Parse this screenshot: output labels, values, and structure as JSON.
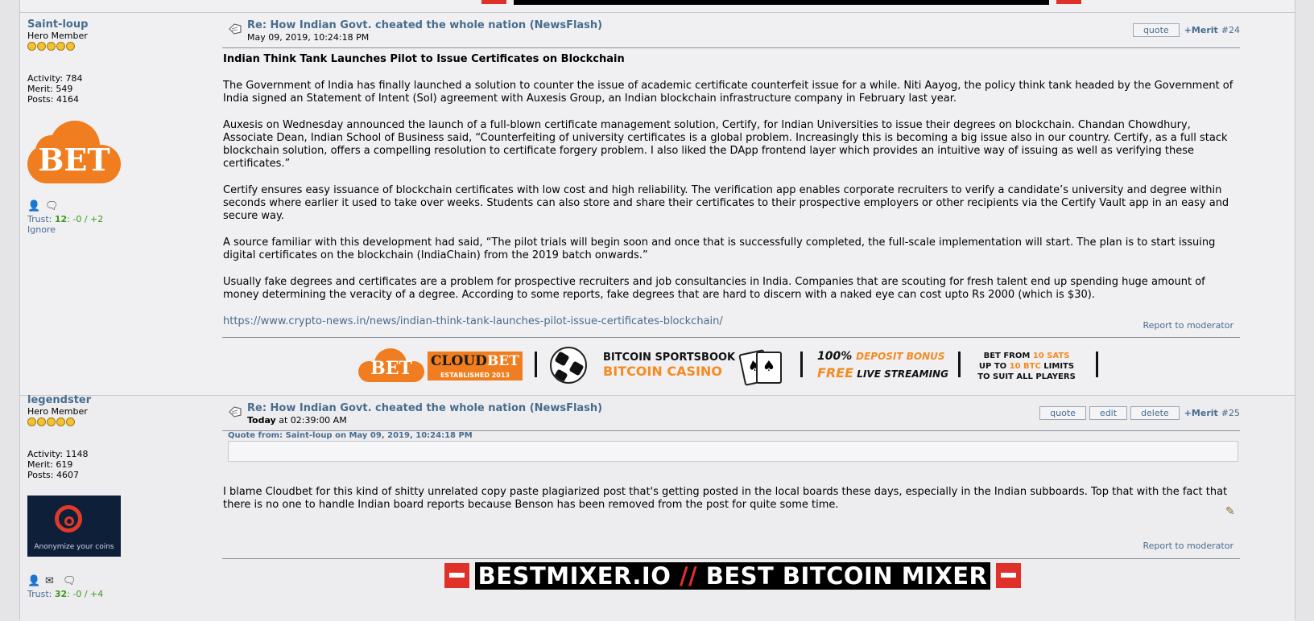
{
  "post1": {
    "poster": {
      "username": "Saint-loup",
      "rank": "Hero Member",
      "activity": "Activity: 784",
      "merit": "Merit: 549",
      "posts": "Posts: 4164",
      "avatar_text": "BET",
      "trust_label": "Trust:",
      "trust_score": "12",
      "trust_detail": ": -0 / +2",
      "ignore": "Ignore"
    },
    "subject": "Re: How Indian Govt. cheated the whole nation (NewsFlash)",
    "date": "May 09, 2019, 10:24:18 PM",
    "buttons": {
      "quote": "quote",
      "merit": "+Merit",
      "number": "#24"
    },
    "body": {
      "heading": "Indian Think Tank Launches Pilot to Issue Certificates on Blockchain",
      "p1": "The Government of India has finally launched a solution to counter the issue of academic certificate counterfeit issue for a while. Niti Aayog, the policy think tank headed by the Government of India signed an Statement of Intent (SoI) agreement with Auxesis Group, an Indian blockchain infrastructure company in February last year.",
      "p2": "Auxesis on Wednesday announced the launch of a full-blown certificate management solution, Certify, for Indian Universities to issue their degrees on blockchain. Chandan Chowdhury, Associate Dean, Indian School of Business said, “Counterfeiting of university certificates is a global problem. Increasingly this is becoming a big issue also in our country. Certify, as a full stack blockchain solution, offers a compelling resolution to certificate forgery problem. I also liked the DApp frontend layer which provides an intuitive way of issuing as well as verifying these certificates.”",
      "p3": "Certify ensures easy issuance of blockchain certificates with low cost and high reliability. The verification app enables corporate recruiters to verify a candidate’s university and degree within seconds where earlier it used to take over weeks. Students can also store and share their certificates to their prospective employers or other recipients via the Certify Vault app in an easy and secure way.",
      "p4": "A source familiar with this development had said, “The pilot trials will begin soon and once that is successfully completed, the full-scale implementation will start. The plan is to start issuing digital certificates on the blockchain (IndiaChain) from the 2019 batch onwards.”",
      "p5": "Usually fake degrees and certificates are a problem for prospective recruiters and job consultancies in India. Companies that are scouting for fresh talent end up spending huge amount of money determining the veracity of a degree. According to some reports, fake degrees that are hard to discern with a naked eye can cost upto Rs 2000 (which is $30).",
      "link": "https://www.crypto-news.in/news/indian-think-tank-launches-pilot-issue-certificates-blockchain/"
    },
    "report": "Report to moderator"
  },
  "ad_cloudbet": {
    "icon_text": "BET",
    "logo_cloud": "CLOUD",
    "logo_bet": "BET",
    "established": "ESTABLISHED 2013",
    "sportsbook": "BITCOIN SPORTSBOOK",
    "casino": "BITCOIN CASINO",
    "deposit_pct": "100%",
    "deposit_bonus": "DEPOSIT BONUS",
    "free": "FREE",
    "live": "LIVE STREAMING",
    "bet_from_a": "BET FROM ",
    "bet_from_b": "10 SATS",
    "up_to_a": "UP TO ",
    "up_to_b": "10 BTC",
    "up_to_c": " LIMITS",
    "suit": "TO SUIT ALL PLAYERS"
  },
  "post2": {
    "poster": {
      "username": "legendster",
      "rank": "Hero Member",
      "activity": "Activity: 1148",
      "merit": "Merit: 619",
      "posts": "Posts: 4607",
      "avatar_caption": "Anonymize your coins",
      "trust_label": "Trust:",
      "trust_score": "32",
      "trust_detail": ": -0 / +4"
    },
    "subject": "Re: How Indian Govt. cheated the whole nation (NewsFlash)",
    "date_bold": "Today",
    "date_rest": " at 02:39:00 AM",
    "buttons": {
      "quote": "quote",
      "edit": "edit",
      "delete": "delete",
      "merit": "+Merit",
      "number": "#25"
    },
    "quote_header": "Quote from: Saint-loup on May 09, 2019, 10:24:18 PM",
    "body": "I blame Cloudbet for this kind of shitty unrelated copy paste plagiarized post that's getting posted in the local boards these days, especially in the Indian subboards. Top that with the fact that there is no one to handle Indian board reports because Benson has been removed from the post for quite some time.",
    "report": "Report to moderator"
  },
  "ad_mixer": {
    "text_a": "BESTMIXER.IO ",
    "text_slash": "//",
    "text_b": " BEST BITCOIN MIXER"
  },
  "colors": {
    "link": "#476c8e",
    "accent_orange": "#f07d1f",
    "mixer_red": "#e0302a",
    "trust_green": "#3a9a1a"
  }
}
